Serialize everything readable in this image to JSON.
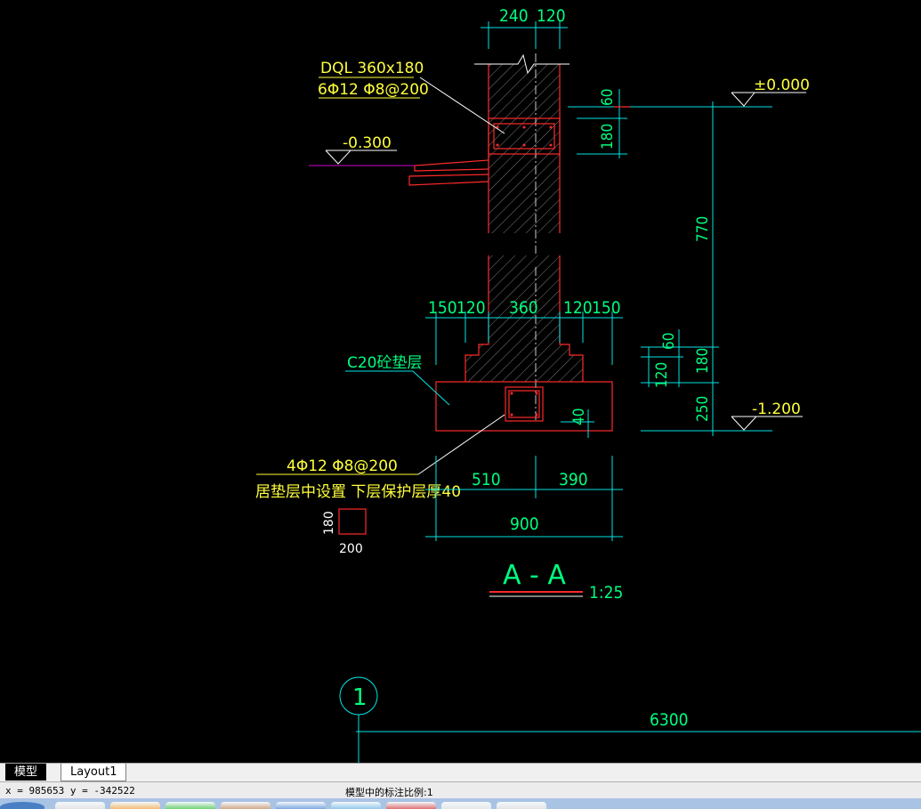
{
  "drawing": {
    "top_dims": [
      "240",
      "120"
    ],
    "beam_label": "DQL 360x180",
    "beam_rebar": "6Φ12  Φ8@200",
    "elev_pos": "±0.000",
    "elev_ground": "-0.300",
    "elev_bottom": "-1.200",
    "right_dims": [
      "60",
      "180",
      "770"
    ],
    "footing_dims": [
      "150",
      "120",
      "360",
      "120",
      "150"
    ],
    "footing_vert": [
      "60",
      "120",
      "180",
      "250"
    ],
    "c20_label": "C20砼垫层",
    "cover_dim": "40",
    "rebar2_label": "4Φ12  Φ8@200",
    "rebar2_note": "居垫层中设置 下层保护层厚40",
    "bottom_dims": [
      "510",
      "390"
    ],
    "total_dim": "900",
    "small_box": [
      "180",
      "200"
    ],
    "section_title": "A - A",
    "section_scale": "1:25",
    "grid_bubble": "1",
    "grid_dim": "6300"
  },
  "tabs": {
    "model": "模型",
    "layout1": "Layout1"
  },
  "status": {
    "coords": "x = 985653  y = -342522",
    "scale_text": "模型中的标注比例:1"
  },
  "taskbar": {
    "buttons": [
      "#d9d9d9",
      "#f0a030",
      "#30c030",
      "#c08050",
      "#4080d0",
      "#60b0e0",
      "#d03030",
      "#e0e0e0"
    ]
  }
}
